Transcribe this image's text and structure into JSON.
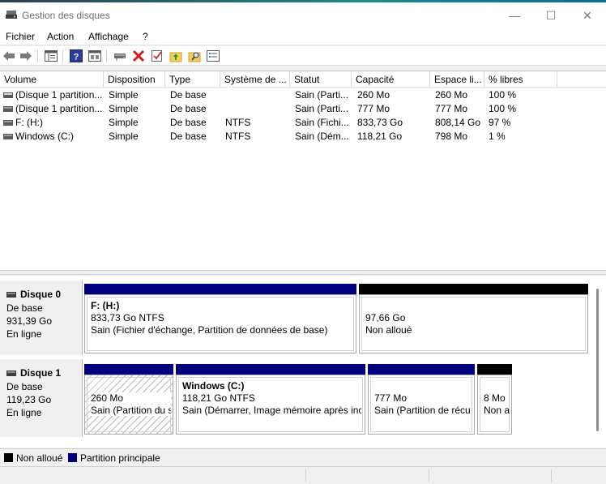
{
  "window": {
    "title": "Gestion des disques",
    "controls": {
      "minimize": "—",
      "maximize": "☐",
      "close": "✕"
    }
  },
  "menubar": {
    "items": [
      "Fichier",
      "Action",
      "Affichage",
      "?"
    ]
  },
  "toolbar": {
    "buttons": [
      "back-icon",
      "forward-icon",
      "console-tree-icon",
      "help-icon",
      "details-pane-icon",
      "connect-drive-icon",
      "delete-icon",
      "properties-icon",
      "up-folder-icon",
      "search-folder-icon",
      "list-view-icon"
    ]
  },
  "volume_list": {
    "columns": [
      "Volume",
      "Disposition",
      "Type",
      "Système de ...",
      "Statut",
      "Capacité",
      "Espace li...",
      "% libres"
    ],
    "rows": [
      [
        "(Disque 1 partition...",
        "Simple",
        "De base",
        "",
        "Sain (Parti...",
        "260 Mo",
        "260 Mo",
        "100 %"
      ],
      [
        "(Disque 1 partition...",
        "Simple",
        "De base",
        "",
        "Sain (Parti...",
        "777 Mo",
        "777 Mo",
        "100 %"
      ],
      [
        "F: (H:)",
        "Simple",
        "De base",
        "NTFS",
        "Sain (Fichi...",
        "833,73 Go",
        "808,14 Go",
        "97 %"
      ],
      [
        "Windows (C:)",
        "Simple",
        "De base",
        "NTFS",
        "Sain (Dém...",
        "118,21 Go",
        "798 Mo",
        "1 %"
      ]
    ]
  },
  "disks": [
    {
      "name": "Disque 0",
      "type": "De base",
      "size": "931,39 Go",
      "status": "En ligne",
      "partitions": [
        {
          "kind": "primary",
          "name": "F:  (H:)",
          "size": "833,73 Go NTFS",
          "status": "Sain (Fichier d'échange, Partition de données de base)"
        },
        {
          "kind": "unallocated",
          "name": "",
          "size": "97,66 Go",
          "status": "Non alloué"
        }
      ]
    },
    {
      "name": "Disque 1",
      "type": "De base",
      "size": "119,23 Go",
      "status": "En ligne",
      "partitions": [
        {
          "kind": "primary",
          "name": "",
          "size": "260 Mo",
          "status": "Sain (Partition du s"
        },
        {
          "kind": "primary",
          "name": "Windows  (C:)",
          "size": "118,21 Go NTFS",
          "status": "Sain (Démarrer, Image mémoire après inci"
        },
        {
          "kind": "primary",
          "name": "",
          "size": "777 Mo",
          "status": "Sain (Partition de récuț"
        },
        {
          "kind": "primary",
          "name": "",
          "size": "8 Mo",
          "status": "Non a"
        }
      ]
    }
  ],
  "legend": [
    {
      "label": "Non alloué",
      "color": "#000000"
    },
    {
      "label": "Partition principale",
      "color": "#00007f"
    }
  ],
  "colors": {
    "primary": "#00007f",
    "unallocated": "#000000",
    "accent": "#1d8a8a"
  }
}
